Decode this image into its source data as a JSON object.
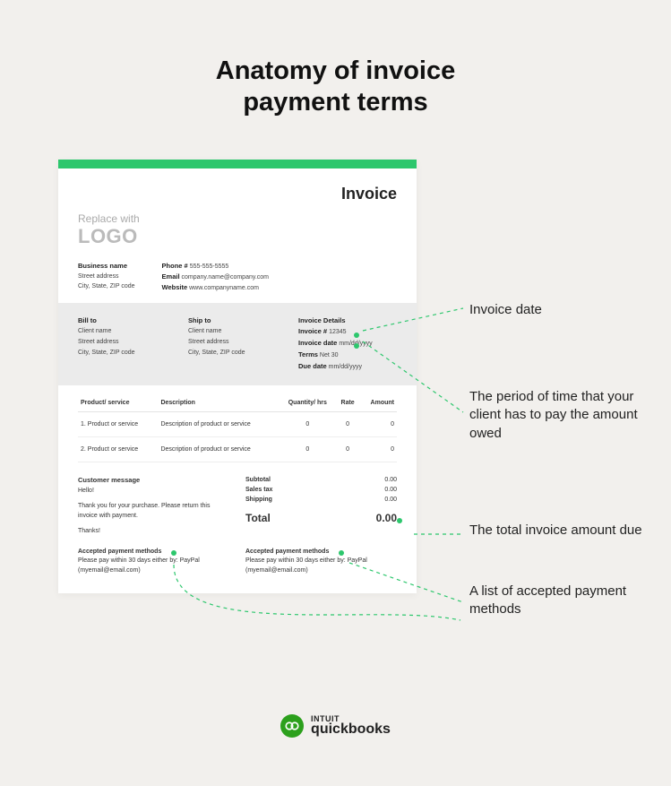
{
  "title_line1": "Anatomy of invoice",
  "title_line2": "payment terms",
  "invoice": {
    "heading": "Invoice",
    "logo_line1": "Replace with",
    "logo_line2": "LOGO",
    "business": {
      "name_label": "Business name",
      "street": "Street address",
      "city": "City, State, ZIP code"
    },
    "contact": {
      "phone_label": "Phone #",
      "phone_value": "555-555-5555",
      "email_label": "Email",
      "email_value": "company.name@company.com",
      "website_label": "Website",
      "website_value": "www.companyname.com"
    },
    "billto": {
      "label": "Bill to",
      "name": "Client name",
      "street": "Street address",
      "city": "City, State, ZIP code"
    },
    "shipto": {
      "label": "Ship to",
      "name": "Client name",
      "street": "Street address",
      "city": "City, State, ZIP code"
    },
    "details": {
      "label": "Invoice Details",
      "number_label": "Invoice #",
      "number_value": "12345",
      "date_label": "Invoice date",
      "date_value": "mm/dd/yyyy",
      "terms_label": "Terms",
      "terms_value": "Net 30",
      "due_label": "Due date",
      "due_value": "mm/dd/yyyy"
    },
    "table": {
      "cols": {
        "product": "Product/ service",
        "desc": "Description",
        "qty": "Quantity/ hrs",
        "rate": "Rate",
        "amount": "Amount"
      },
      "rows": [
        {
          "product": "1. Product or service",
          "desc": "Description of product or service",
          "qty": "0",
          "rate": "0",
          "amount": "0"
        },
        {
          "product": "2. Product or service",
          "desc": "Description of product or service",
          "qty": "0",
          "rate": "0",
          "amount": "0"
        }
      ]
    },
    "message": {
      "label": "Customer message",
      "greeting": "Hello!",
      "body": "Thank you for your purchase. Please return this invoice with payment.",
      "signoff": "Thanks!"
    },
    "summary": {
      "subtotal_label": "Subtotal",
      "subtotal_value": "0.00",
      "tax_label": "Sales tax",
      "tax_value": "0.00",
      "ship_label": "Shipping",
      "ship_value": "0.00",
      "total_label": "Total",
      "total_value": "0.00"
    },
    "accepted": {
      "label": "Accepted payment methods",
      "text": "Please pay within 30 days either by: PayPal (myemail@email.com)"
    }
  },
  "annotations": {
    "a1": "Invoice date",
    "a2": "The period of time that your client has to pay the amount owed",
    "a3": "The total invoice amount due",
    "a4": "A list of accepted payment methods"
  },
  "brand": {
    "intuit": "INTUIT",
    "qb": "quickbooks"
  },
  "colors": {
    "accent": "#2dc76d"
  }
}
